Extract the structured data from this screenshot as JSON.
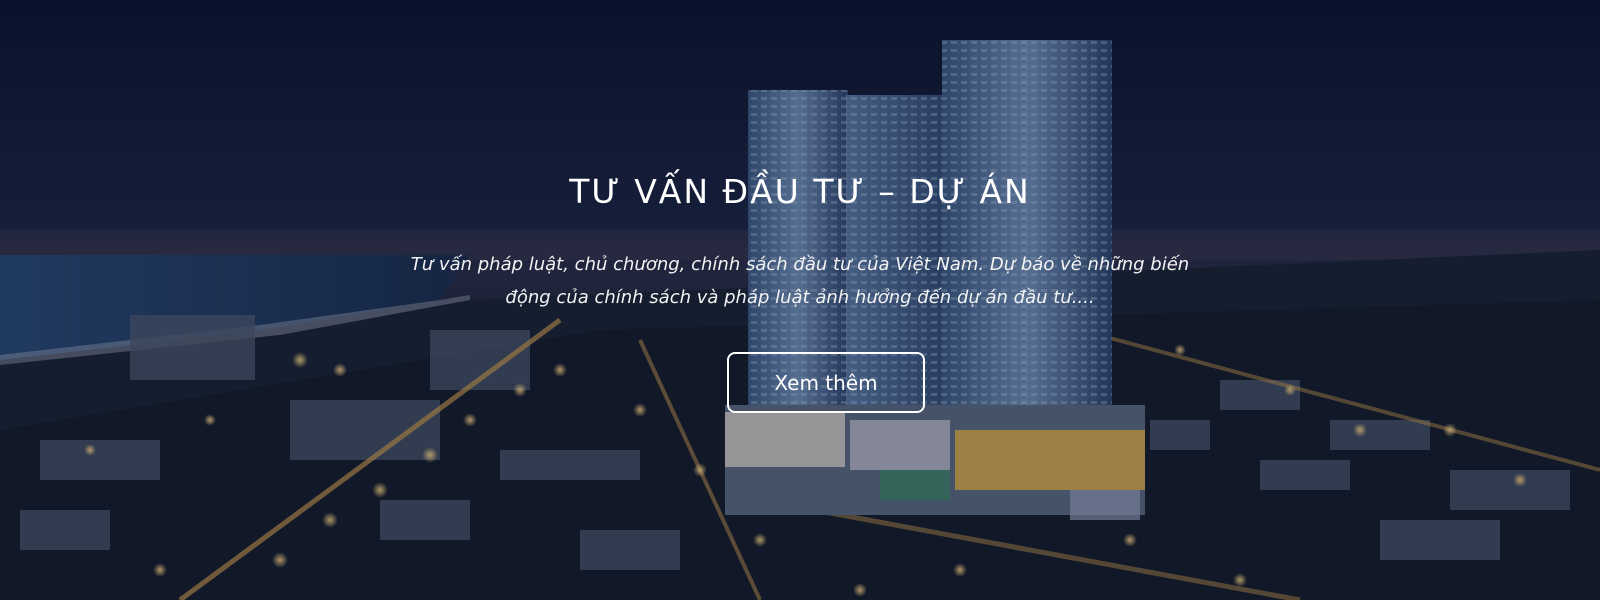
{
  "hero": {
    "title": "TƯ VẤN ĐẦU TƯ – DỰ ÁN",
    "description": "Tư vấn pháp luật, chủ chương, chính sách đầu tư của Việt Nam. Dự báo về những biến động của chính sách và pháp luật ảnh hưởng đến dự án đầu tư....",
    "button_label": "Xem thêm",
    "background_image": "night-city-skyline-with-residential-towers"
  },
  "colors": {
    "text": "#ffffff",
    "sky": "#0d1530",
    "sea": "#24406a",
    "city_lights": "#ffd37a"
  }
}
